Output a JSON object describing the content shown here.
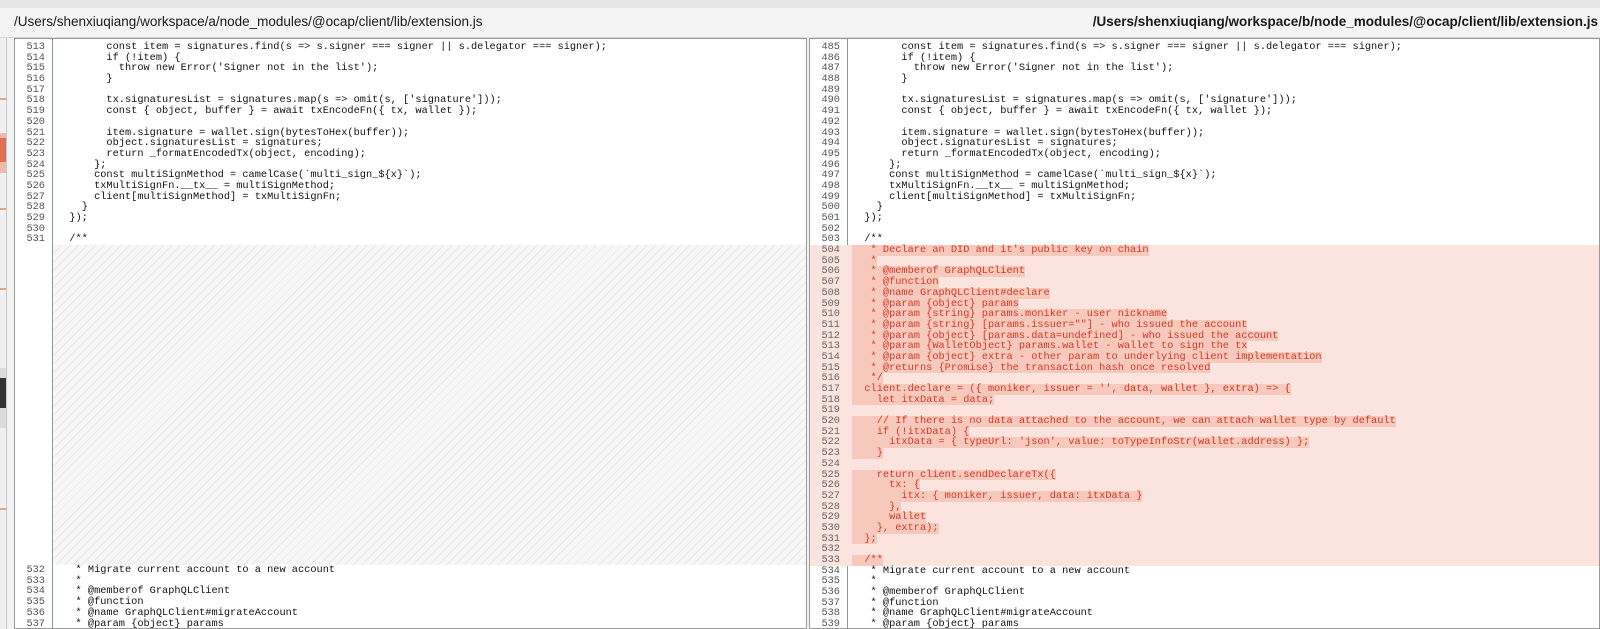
{
  "paths": {
    "left": "/Users/shenxiuqiang/workspace/a/node_modules/@ocap/client/lib/extension.js",
    "right": "/Users/shenxiuqiang/workspace/b/node_modules/@ocap/client/lib/extension.js"
  },
  "colors": {
    "added_bg": "#fbe3de",
    "added_text": "#d33a22",
    "gutter_line": "#7f9d92"
  },
  "left": {
    "top": [
      {
        "n": "513",
        "t": "        const item = signatures.find(s => s.signer === signer || s.delegator === signer);"
      },
      {
        "n": "514",
        "t": "        if (!item) {"
      },
      {
        "n": "515",
        "t": "          throw new Error('Signer not in the list');"
      },
      {
        "n": "516",
        "t": "        }"
      },
      {
        "n": "517",
        "t": ""
      },
      {
        "n": "518",
        "t": "        tx.signaturesList = signatures.map(s => omit(s, ['signature']));"
      },
      {
        "n": "519",
        "t": "        const { object, buffer } = await txEncodeFn({ tx, wallet });"
      },
      {
        "n": "520",
        "t": ""
      },
      {
        "n": "521",
        "t": "        item.signature = wallet.sign(bytesToHex(buffer));"
      },
      {
        "n": "522",
        "t": "        object.signaturesList = signatures;"
      },
      {
        "n": "523",
        "t": "        return _formatEncodedTx(object, encoding);"
      },
      {
        "n": "524",
        "t": "      };"
      },
      {
        "n": "525",
        "t": "      const multiSignMethod = camelCase(`multi_sign_${x}`);"
      },
      {
        "n": "526",
        "t": "      txMultiSignFn.__tx__ = multiSignMethod;"
      },
      {
        "n": "527",
        "t": "      client[multiSignMethod] = txMultiSignFn;"
      },
      {
        "n": "528",
        "t": "    }"
      },
      {
        "n": "529",
        "t": "  });"
      },
      {
        "n": "530",
        "t": ""
      },
      {
        "n": "531",
        "t": "  /**"
      }
    ],
    "bottom": [
      {
        "n": "532",
        "t": "   * Migrate current account to a new account"
      },
      {
        "n": "533",
        "t": "   *"
      },
      {
        "n": "534",
        "t": "   * @memberof GraphQLClient"
      },
      {
        "n": "535",
        "t": "   * @function"
      },
      {
        "n": "536",
        "t": "   * @name GraphQLClient#migrateAccount"
      },
      {
        "n": "537",
        "t": "   * @param {object} params"
      }
    ]
  },
  "right": {
    "top": [
      {
        "n": "485",
        "t": "        const item = signatures.find(s => s.signer === signer || s.delegator === signer);"
      },
      {
        "n": "486",
        "t": "        if (!item) {"
      },
      {
        "n": "487",
        "t": "          throw new Error('Signer not in the list');"
      },
      {
        "n": "488",
        "t": "        }"
      },
      {
        "n": "489",
        "t": ""
      },
      {
        "n": "490",
        "t": "        tx.signaturesList = signatures.map(s => omit(s, ['signature']));"
      },
      {
        "n": "491",
        "t": "        const { object, buffer } = await txEncodeFn({ tx, wallet });"
      },
      {
        "n": "492",
        "t": ""
      },
      {
        "n": "493",
        "t": "        item.signature = wallet.sign(bytesToHex(buffer));"
      },
      {
        "n": "494",
        "t": "        object.signaturesList = signatures;"
      },
      {
        "n": "495",
        "t": "        return _formatEncodedTx(object, encoding);"
      },
      {
        "n": "496",
        "t": "      };"
      },
      {
        "n": "497",
        "t": "      const multiSignMethod = camelCase(`multi_sign_${x}`);"
      },
      {
        "n": "498",
        "t": "      txMultiSignFn.__tx__ = multiSignMethod;"
      },
      {
        "n": "499",
        "t": "      client[multiSignMethod] = txMultiSignFn;"
      },
      {
        "n": "500",
        "t": "    }"
      },
      {
        "n": "501",
        "t": "  });"
      },
      {
        "n": "502",
        "t": ""
      },
      {
        "n": "503",
        "t": "  /**"
      }
    ],
    "added": [
      {
        "n": "504",
        "t": "   * Declare an DID and it's public key on chain"
      },
      {
        "n": "505",
        "t": "   *"
      },
      {
        "n": "506",
        "t": "   * @memberof GraphQLClient"
      },
      {
        "n": "507",
        "t": "   * @function"
      },
      {
        "n": "508",
        "t": "   * @name GraphQLClient#declare"
      },
      {
        "n": "509",
        "t": "   * @param {object} params"
      },
      {
        "n": "510",
        "t": "   * @param {string} params.moniker - user nickname"
      },
      {
        "n": "511",
        "t": "   * @param {string} [params.issuer=\"\"] - who issued the account"
      },
      {
        "n": "512",
        "t": "   * @param {object} [params.data=undefined] - who issued the account"
      },
      {
        "n": "513",
        "t": "   * @param {WalletObject} params.wallet - wallet to sign the tx"
      },
      {
        "n": "514",
        "t": "   * @param {object} extra - other param to underlying client implementation"
      },
      {
        "n": "515",
        "t": "   * @returns {Promise} the transaction hash once resolved"
      },
      {
        "n": "516",
        "t": "   */"
      },
      {
        "n": "517",
        "t": "  client.declare = ({ moniker, issuer = '', data, wallet }, extra) => {"
      },
      {
        "n": "518",
        "t": "    let itxData = data;"
      },
      {
        "n": "519",
        "t": ""
      },
      {
        "n": "520",
        "t": "    // If there is no data attached to the account, we can attach wallet type by default"
      },
      {
        "n": "521",
        "t": "    if (!itxData) {"
      },
      {
        "n": "522",
        "t": "      itxData = { typeUrl: 'json', value: toTypeInfoStr(wallet.address) };"
      },
      {
        "n": "523",
        "t": "    }"
      },
      {
        "n": "524",
        "t": ""
      },
      {
        "n": "525",
        "t": "    return client.sendDeclareTx({"
      },
      {
        "n": "526",
        "t": "      tx: {"
      },
      {
        "n": "527",
        "t": "        itx: { moniker, issuer, data: itxData }"
      },
      {
        "n": "528",
        "t": "      },"
      },
      {
        "n": "529",
        "t": "      wallet"
      },
      {
        "n": "530",
        "t": "    }, extra);"
      },
      {
        "n": "531",
        "t": "  };"
      },
      {
        "n": "532",
        "t": ""
      },
      {
        "n": "533",
        "t": "  /**"
      }
    ],
    "bottom": [
      {
        "n": "534",
        "t": "   * Migrate current account to a new account"
      },
      {
        "n": "535",
        "t": "   *"
      },
      {
        "n": "536",
        "t": "   * @memberof GraphQLClient"
      },
      {
        "n": "537",
        "t": "   * @function"
      },
      {
        "n": "538",
        "t": "   * @name GraphQLClient#migrateAccount"
      },
      {
        "n": "539",
        "t": "   * @param {object} params"
      }
    ]
  }
}
